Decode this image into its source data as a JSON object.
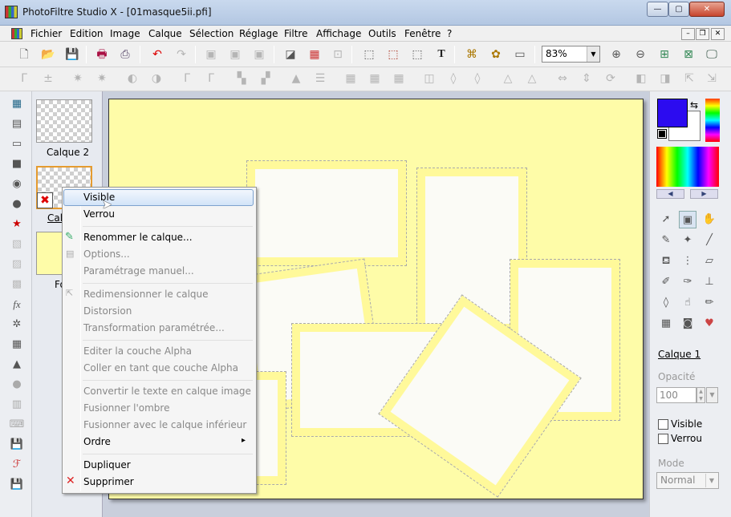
{
  "window": {
    "title": "PhotoFiltre Studio X - [01masque5ii.pfi]",
    "minimize": "—",
    "maximize": "▢",
    "close": "✕"
  },
  "menu": [
    "Fichier",
    "Edition",
    "Image",
    "Calque",
    "Sélection",
    "Réglage",
    "Filtre",
    "Affichage",
    "Outils",
    "Fenêtre",
    "?"
  ],
  "mdi": {
    "minimize": "–",
    "restore": "❐",
    "close": "✕"
  },
  "toolbar": {
    "zoom_value": "83%",
    "text_tool": "T"
  },
  "layers": {
    "layer2_label": "Calque 2",
    "layer1_label_partial": "Cal",
    "background_label_partial": "Fo"
  },
  "context_menu": {
    "items": [
      "Visible",
      "Verrou",
      "Renommer le calque...",
      "Options...",
      "Paramétrage manuel...",
      "Redimensionner le calque",
      "Distorsion",
      "Transformation paramétrée...",
      "Editer la couche Alpha",
      "Coller en tant que couche Alpha",
      "Convertir le texte en calque image",
      "Fusionner l'ombre",
      "Fusionner avec le calque inférieur",
      "Ordre",
      "Dupliquer",
      "Supprimer"
    ],
    "submenu_arrow": "▸"
  },
  "panel": {
    "layer_name": "Calque 1",
    "opacity_label": "Opacité",
    "opacity_value": "100",
    "visible_label": "Visible",
    "lock_label": "Verrou",
    "mode_label": "Mode",
    "mode_value": "Normal"
  },
  "colors": {
    "foreground": "#2c0bf0",
    "background": "#ffffff",
    "canvas_bg": "#fefca8"
  }
}
